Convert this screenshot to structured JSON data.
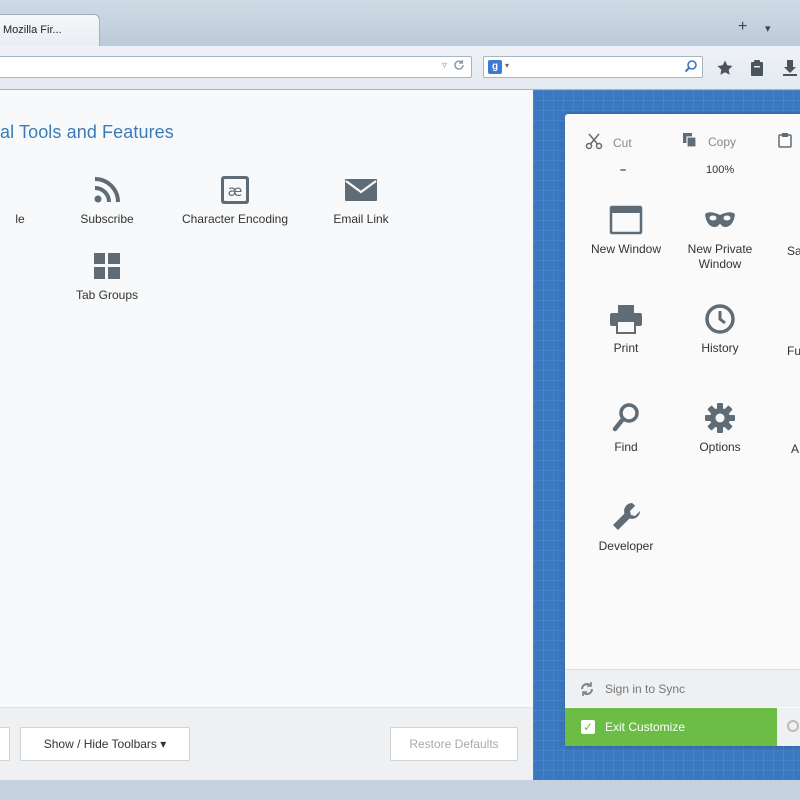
{
  "browser": {
    "tab_title": "Mozilla Fir...",
    "newtab_glyph": "+",
    "tablist_glyph": "▾",
    "urlbar_dropdown_glyph": "▿",
    "search_engine_badge": "g",
    "search_dropdown_glyph": "▾"
  },
  "workspace": {
    "title": "al Tools and Features",
    "tools": [
      {
        "label": "le",
        "icon": "partial-icon"
      },
      {
        "label": "Subscribe",
        "icon": "rss-icon"
      },
      {
        "label": "Character Encoding",
        "icon": "character-encoding-icon"
      },
      {
        "label": "Email Link",
        "icon": "envelope-icon"
      },
      {
        "label": "Tab Groups",
        "icon": "tab-groups-icon"
      }
    ]
  },
  "footer": {
    "show_hide_toolbars": "Show / Hide Toolbars ▾",
    "restore_defaults": "Restore Defaults"
  },
  "menu": {
    "edit": {
      "cut": "Cut",
      "copy": "Copy"
    },
    "zoom": {
      "minus": "–",
      "level": "100%"
    },
    "items": [
      {
        "label": "New Window",
        "icon": "new-window-icon"
      },
      {
        "label": "New Private Window",
        "icon": "mask-icon"
      },
      {
        "label": "Print",
        "icon": "printer-icon"
      },
      {
        "label": "History",
        "icon": "clock-icon"
      },
      {
        "label": "Find",
        "icon": "magnifier-icon"
      },
      {
        "label": "Options",
        "icon": "gear-icon"
      },
      {
        "label": "Developer",
        "icon": "wrench-icon"
      }
    ],
    "partial_labels": {
      "save": "Sa",
      "full": "Fu",
      "addons": "A"
    },
    "sign_in_sync": "Sign in to Sync",
    "exit_customize": "Exit Customize"
  },
  "colors": {
    "accent_blue": "#3a78c0",
    "title_blue": "#3b7bb8",
    "exit_green": "#6cbd45",
    "icon_gray": "#5f6b75"
  }
}
